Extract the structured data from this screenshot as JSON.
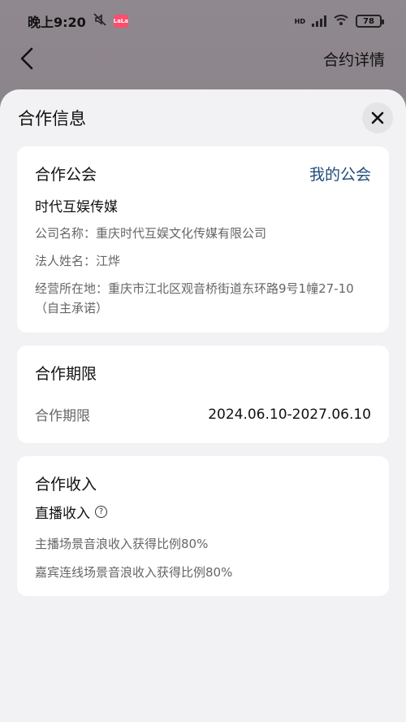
{
  "status_bar": {
    "time": "晚上9:20",
    "app_badge": "LaLa",
    "battery": "78",
    "network": "HD"
  },
  "nav": {
    "title": "合约详情"
  },
  "sheet": {
    "title": "合作信息"
  },
  "cooperation_union": {
    "title": "合作公会",
    "link": "我的公会",
    "union_name": "时代互娱传媒",
    "company_line": "公司名称：重庆时代互娱文化传媒有限公司",
    "legal_line": "法人姓名：江烨",
    "address_line1": "经营所在地：重庆市江北区观音桥街道东环路9号1幢27-10",
    "address_line2": "（自主承诺）"
  },
  "cooperation_period": {
    "title": "合作期限",
    "label": "合作期限",
    "value": "2024.06.10-2027.06.10"
  },
  "cooperation_income": {
    "title": "合作收入",
    "sub_title": "直播收入",
    "line1": "主播场景音浪收入获得比例80%",
    "line2": "嘉宾连线场景音浪收入获得比例80%"
  }
}
